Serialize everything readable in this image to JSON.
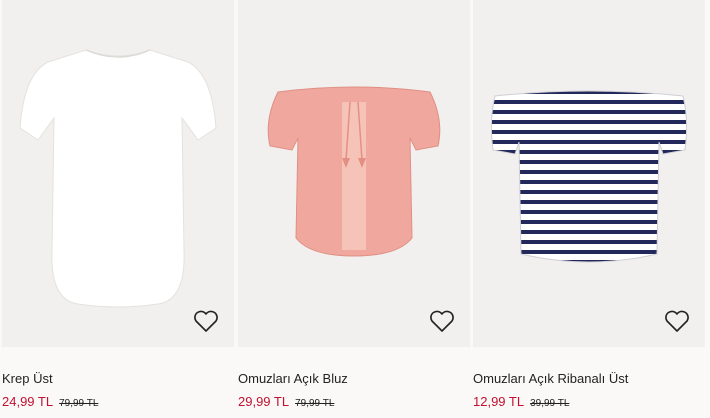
{
  "products": [
    {
      "name": "Krep Üst",
      "sale_price": "24,99 TL",
      "old_price": "79,99 TL",
      "image": "white-tshirt-image",
      "color": "#ffffff"
    },
    {
      "name": "Omuzları Açık Bluz",
      "sale_price": "29,99 TL",
      "old_price": "79,99 TL",
      "image": "pink-off-shoulder-blouse-image",
      "color": "#f0a79d"
    },
    {
      "name": "Omuzları Açık Ribanalı Üst",
      "sale_price": "12,99 TL",
      "old_price": "39,99 TL",
      "image": "navy-striped-off-shoulder-top-image",
      "color": "#22295a"
    }
  ],
  "colors": {
    "sale": "#c3102f",
    "background": "#faf9f8",
    "image_bg": "#f1f0ee"
  },
  "icons": {
    "favorite": "heart-outline-icon"
  }
}
